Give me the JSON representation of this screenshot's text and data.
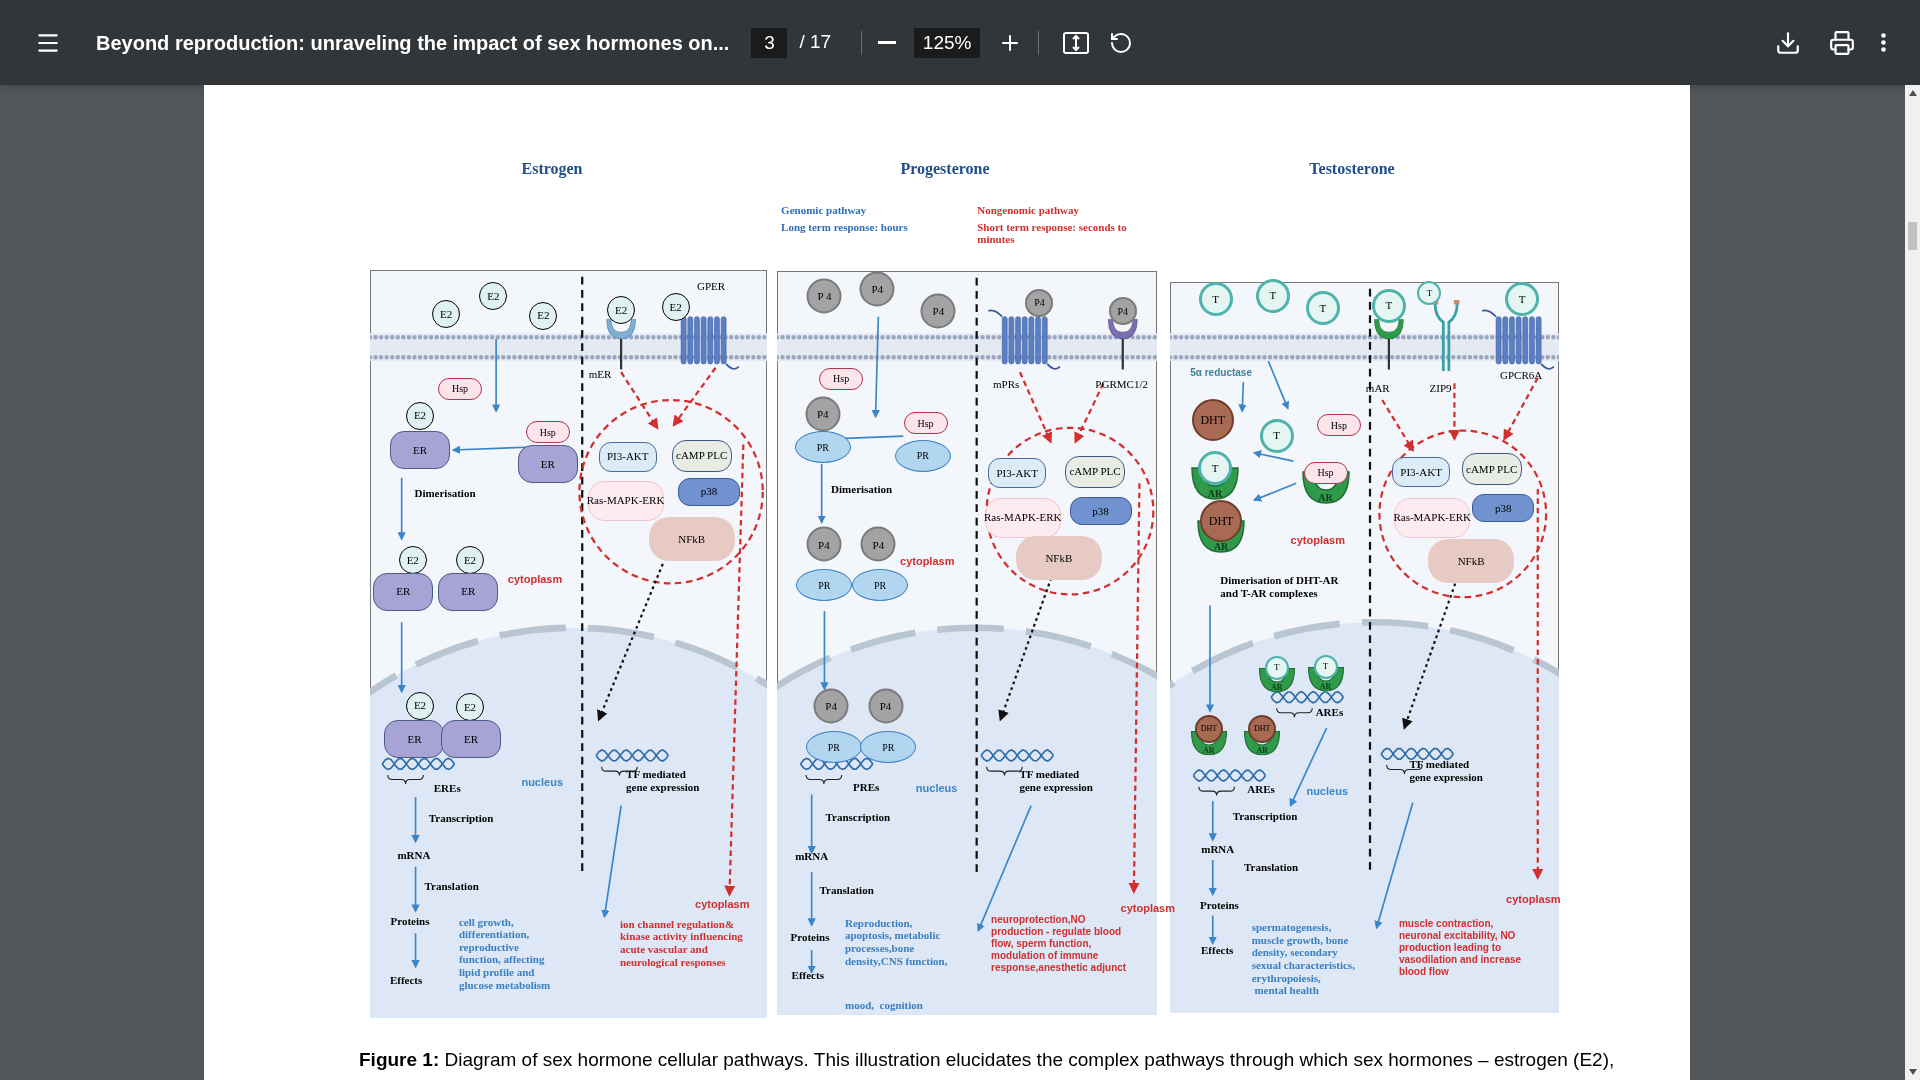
{
  "toolbar": {
    "title": "Beyond reproduction: unraveling the impact of sex hormones on...",
    "page": "3",
    "page_total": "/ 17",
    "zoom": "125%"
  },
  "panels": [
    {
      "title": "Estrogen",
      "items": [
        {
          "kind": "e2",
          "text": "E2"
        },
        {
          "kind": "e2",
          "text": "E2"
        },
        {
          "kind": "e2",
          "text": "E2"
        },
        {
          "kind": "e2",
          "text": "E2"
        },
        {
          "kind": "e2",
          "text": "E2"
        },
        {
          "kind": "rlabel",
          "text": "GPER"
        },
        {
          "kind": "rlabel",
          "text": "mER"
        },
        {
          "kind": "hsp",
          "text": "Hsp"
        },
        {
          "kind": "e2",
          "text": "E2"
        },
        {
          "kind": "er",
          "text": "ER"
        },
        {
          "kind": "hsp",
          "text": "Hsp"
        },
        {
          "kind": "er",
          "text": "ER"
        },
        {
          "kind": "label",
          "text": "Dimerisation"
        },
        {
          "kind": "e2",
          "text": "E2"
        },
        {
          "kind": "e2",
          "text": "E2"
        },
        {
          "kind": "er",
          "text": "ER"
        },
        {
          "kind": "er",
          "text": "ER"
        },
        {
          "kind": "region-red",
          "text": "cytoplasm"
        },
        {
          "kind": "akt",
          "text": "PI3-AKT"
        },
        {
          "kind": "camp",
          "text": "cAMP PLC"
        },
        {
          "kind": "ras",
          "text": "Ras-MAPK-ERK"
        },
        {
          "kind": "p38",
          "text": "p38"
        },
        {
          "kind": "nfkb",
          "text": "NFkB"
        },
        {
          "kind": "e2",
          "text": "E2"
        },
        {
          "kind": "e2",
          "text": "E2"
        },
        {
          "kind": "er",
          "text": "ER"
        },
        {
          "kind": "er",
          "text": "ER"
        },
        {
          "kind": "label",
          "text": "EREs"
        },
        {
          "kind": "region-blue",
          "text": "nucleus"
        },
        {
          "kind": "label",
          "text": "TF mediated\ngene expression"
        },
        {
          "kind": "label",
          "text": "Transcription"
        },
        {
          "kind": "label",
          "text": "mRNA"
        },
        {
          "kind": "label",
          "text": "Translation"
        },
        {
          "kind": "label",
          "text": "Proteins"
        },
        {
          "kind": "label",
          "text": "Effects"
        },
        {
          "kind": "region-red",
          "text": "cytoplasm"
        },
        {
          "kind": "effect-blue",
          "text": "cell growth,\ndifferentiation,\nreproductive\nfunction, affecting\nlipid profile and\nglucose metabolism"
        },
        {
          "kind": "effect-red",
          "text": "ion channel regulation&\nkinase activity influencing\nacute vascular and\nneurological responses"
        }
      ]
    },
    {
      "title": "Progesterone",
      "items": [
        {
          "kind": "note-blue",
          "text": "Genomic pathway"
        },
        {
          "kind": "note-blue",
          "text": "Long term response: hours"
        },
        {
          "kind": "note-red",
          "text": "Nongenomic pathway"
        },
        {
          "kind": "note-red",
          "text": "Short term response: seconds to\nminutes"
        },
        {
          "kind": "p4",
          "text": "P 4"
        },
        {
          "kind": "p4",
          "text": "P4"
        },
        {
          "kind": "p4",
          "text": "P4"
        },
        {
          "kind": "p4s",
          "text": "P4"
        },
        {
          "kind": "p4s",
          "text": "P4"
        },
        {
          "kind": "rlabel",
          "text": "mPRs"
        },
        {
          "kind": "rlabel",
          "text": "PGRMC1/2"
        },
        {
          "kind": "hsp",
          "text": "Hsp"
        },
        {
          "kind": "p4",
          "text": "P4"
        },
        {
          "kind": "pr",
          "text": "PR"
        },
        {
          "kind": "hsp",
          "text": "Hsp"
        },
        {
          "kind": "pr",
          "text": "PR"
        },
        {
          "kind": "label",
          "text": "Dimerisation"
        },
        {
          "kind": "p4",
          "text": "P4"
        },
        {
          "kind": "p4",
          "text": "P4"
        },
        {
          "kind": "pr",
          "text": "PR"
        },
        {
          "kind": "pr",
          "text": "PR"
        },
        {
          "kind": "region-red",
          "text": "cytoplasm"
        },
        {
          "kind": "akt",
          "text": "PI3-AKT"
        },
        {
          "kind": "camp",
          "text": "cAMP PLC"
        },
        {
          "kind": "ras",
          "text": "Ras-MAPK-ERK"
        },
        {
          "kind": "p38",
          "text": "p38"
        },
        {
          "kind": "nfkb",
          "text": "NFkB"
        },
        {
          "kind": "p4",
          "text": "P4"
        },
        {
          "kind": "p4",
          "text": "P4"
        },
        {
          "kind": "pr",
          "text": "PR"
        },
        {
          "kind": "pr",
          "text": "PR"
        },
        {
          "kind": "label",
          "text": "PREs"
        },
        {
          "kind": "region-blue",
          "text": "nucleus"
        },
        {
          "kind": "label",
          "text": "TF mediated\ngene expression"
        },
        {
          "kind": "label",
          "text": "Transcription"
        },
        {
          "kind": "label",
          "text": "mRNA"
        },
        {
          "kind": "label",
          "text": "Translation"
        },
        {
          "kind": "label",
          "text": "Proteins"
        },
        {
          "kind": "label",
          "text": "Effects"
        },
        {
          "kind": "region-red",
          "text": "cytoplasm"
        },
        {
          "kind": "effect-blue",
          "text": "Reproduction,\napoptosis, metabolic\nprocesses,bone\ndensity,CNS function,"
        },
        {
          "kind": "effect-blue",
          "text": "mood,  cognition"
        },
        {
          "kind": "effect-red-sans",
          "text": "neuroprotection,NO\nproduction - regulate blood\nflow, sperm function,\nmodulation of immune\nresponse,anesthetic adjunct"
        }
      ]
    },
    {
      "title": "Testosterone",
      "items": [
        {
          "kind": "t",
          "text": "T"
        },
        {
          "kind": "t",
          "text": "T"
        },
        {
          "kind": "t",
          "text": "T"
        },
        {
          "kind": "t",
          "text": "T"
        },
        {
          "kind": "ts",
          "text": "T"
        },
        {
          "kind": "t",
          "text": "T"
        },
        {
          "kind": "enzyme",
          "text": "5α reductase"
        },
        {
          "kind": "rlabel",
          "text": "mAR"
        },
        {
          "kind": "rlabel",
          "text": "ZIP9"
        },
        {
          "kind": "rlabel",
          "text": "GPCR6A"
        },
        {
          "kind": "dht",
          "text": "DHT"
        },
        {
          "kind": "t",
          "text": "T"
        },
        {
          "kind": "hsp",
          "text": "Hsp"
        },
        {
          "kind": "t",
          "text": "T"
        },
        {
          "kind": "ar",
          "text": "AR"
        },
        {
          "kind": "hsp",
          "text": "Hsp"
        },
        {
          "kind": "ar",
          "text": "AR"
        },
        {
          "kind": "dht",
          "text": "DHT"
        },
        {
          "kind": "ar",
          "text": "AR"
        },
        {
          "kind": "region-red",
          "text": "cytoplasm"
        },
        {
          "kind": "label",
          "text": "Dimerisation of DHT-AR\nand T-AR complexes"
        },
        {
          "kind": "akt",
          "text": "PI3-AKT"
        },
        {
          "kind": "camp",
          "text": "cAMP PLC"
        },
        {
          "kind": "ras",
          "text": "Ras-MAPK-ERK"
        },
        {
          "kind": "p38",
          "text": "p38"
        },
        {
          "kind": "nfkb",
          "text": "NFkB"
        },
        {
          "kind": "ts",
          "text": "T"
        },
        {
          "kind": "ars",
          "text": "AR"
        },
        {
          "kind": "ts",
          "text": "T"
        },
        {
          "kind": "ars",
          "text": "AR"
        },
        {
          "kind": "label",
          "text": "AREs"
        },
        {
          "kind": "dhts",
          "text": "DHT"
        },
        {
          "kind": "ars",
          "text": "AR"
        },
        {
          "kind": "dhts",
          "text": "DHT"
        },
        {
          "kind": "ars",
          "text": "AR"
        },
        {
          "kind": "label",
          "text": "AREs"
        },
        {
          "kind": "region-blue",
          "text": "nucleus"
        },
        {
          "kind": "label",
          "text": "TF mediated\ngene expression"
        },
        {
          "kind": "label",
          "text": "Transcription"
        },
        {
          "kind": "label",
          "text": "mRNA"
        },
        {
          "kind": "label",
          "text": "Translation"
        },
        {
          "kind": "label",
          "text": "Proteins"
        },
        {
          "kind": "label",
          "text": "Effects"
        },
        {
          "kind": "region-red",
          "text": "cytoplasm"
        },
        {
          "kind": "effect-blue",
          "text": "spermatogenesis,\nmuscle growth, bone\ndensity, secondary\nsexual characteristics,\nerythropoiesis,\n mental health"
        },
        {
          "kind": "effect-red-sans",
          "text": "muscle contraction,\nneuronal excitability, NO\nproduction leading to\nvasodilation and increase\nblood flow"
        }
      ]
    }
  ],
  "caption": "**Figure 1:**  Diagram of sex hormone cellular pathways. This illustration elucidates the complex pathways through which sex hormones – estrogen (E2),"
}
